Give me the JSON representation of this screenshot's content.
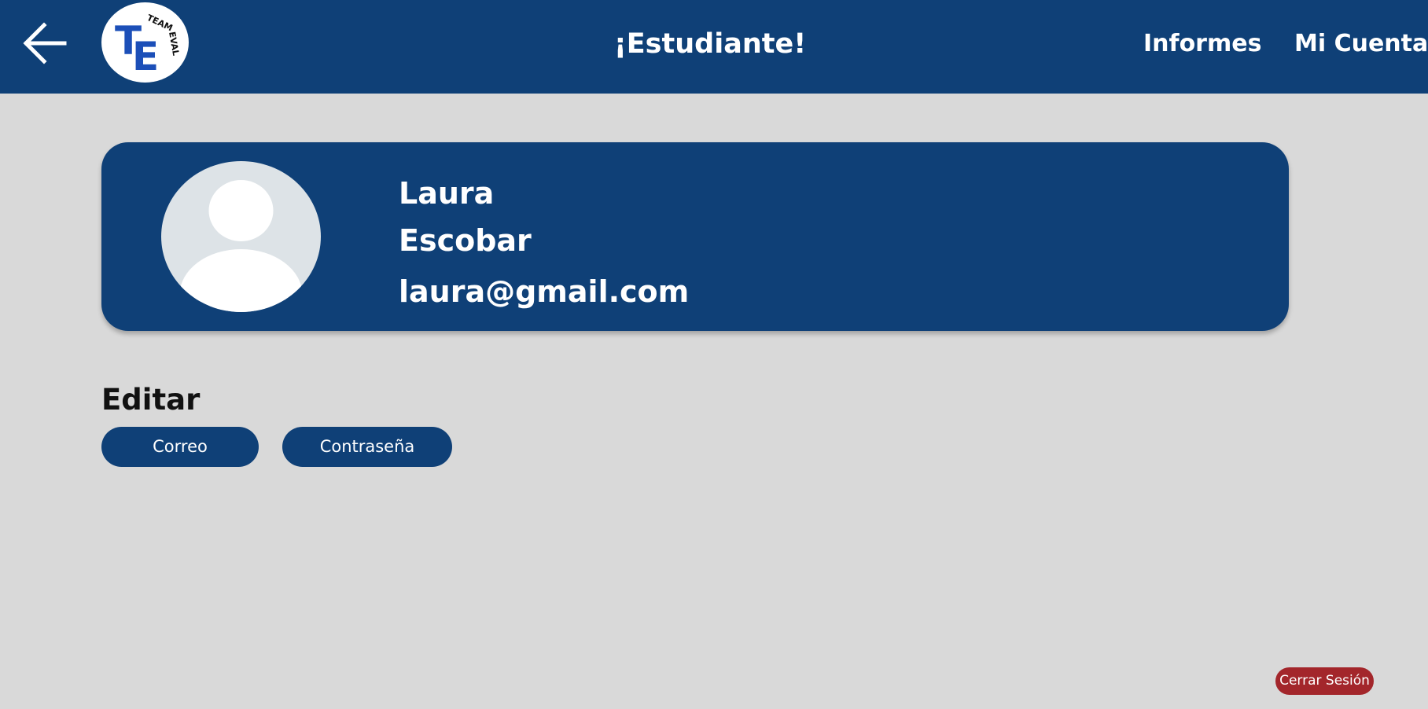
{
  "header": {
    "title": "¡Estudiante!",
    "back_icon": "arrow-left-icon",
    "logo": {
      "initials_top": "T",
      "initials_bottom": "E",
      "arc_text": "TEAM EVAL"
    },
    "nav": [
      {
        "label": "Informes"
      },
      {
        "label": "Mi Cuenta"
      }
    ]
  },
  "profile": {
    "avatar_icon": "user-avatar-icon",
    "first_name": "Laura",
    "last_name": "Escobar",
    "email": "laura@gmail.com"
  },
  "edit": {
    "heading": "Editar",
    "buttons": [
      {
        "label": "Correo"
      },
      {
        "label": "Contraseña"
      }
    ]
  },
  "logout": {
    "label": "Cerrar Sesión"
  },
  "colors": {
    "primary": "#0f4077",
    "background": "#d9d9d9",
    "danger": "#a3262b",
    "avatar_bg": "#dde3e7",
    "logo_blue": "#1c4fb8"
  }
}
